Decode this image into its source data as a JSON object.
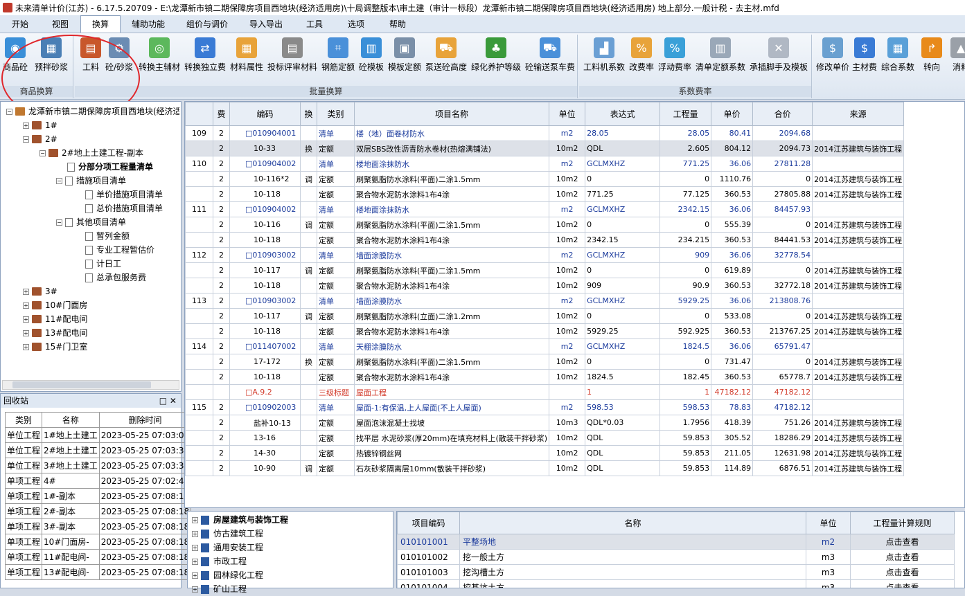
{
  "window": {
    "title": "未来清单计价(江苏) - 6.17.5.20709 - E:\\龙潭新市镇二期保障房项目西地块(经济适用房)\\十局调整版本\\审土建（审计一标段）龙潭新市镇二期保障房项目西地块(经济适用房) 地上部分.一般计税 - 去主材.mfd"
  },
  "menu": [
    "开始",
    "视图",
    "换算",
    "辅助功能",
    "组价与调价",
    "导入导出",
    "工具",
    "选项",
    "帮助"
  ],
  "ribbon": {
    "group1": {
      "label": "商品换算",
      "buttons": [
        "商品砼",
        "预拌砂浆"
      ]
    },
    "group2": {
      "label": "批量换算",
      "buttons": [
        "工料",
        "砼/砂浆",
        "转换主辅材",
        "转换独立费",
        "材料属性",
        "投标评审材料",
        "钢筋定额",
        "砼模板",
        "模板定额",
        "泵送砼高度",
        "绿化养护等级",
        "砼输送泵车费"
      ]
    },
    "group3": {
      "label": "系数费率",
      "buttons": [
        "工料机系数",
        "改费率",
        "浮动费率",
        "清单定额系数",
        "承插脚手及模板"
      ]
    },
    "group4": {
      "buttons": [
        "修改单价",
        "主材费",
        "综合系数",
        "转向",
        "消耗"
      ]
    }
  },
  "colors": {
    "accent": "#1a3a9c",
    "level": "#d23a2a",
    "annotation": "#e0262b"
  },
  "tree": {
    "root": "龙潭新市镇二期保障房项目西地块(经济适用房)",
    "items": [
      "1#",
      "2#",
      "2#地上土建工程-副本",
      "分部分项工程量清单",
      "措施项目清单",
      "单价措施项目清单",
      "总价措施项目清单",
      "其他项目清单",
      "暂列金额",
      "专业工程暂估价",
      "计日工",
      "总承包服务费",
      "3#",
      "10#门面房",
      "11#配电间",
      "13#配电间",
      "15#门卫室"
    ]
  },
  "recycle": {
    "title": "回收站",
    "headers": [
      "类别",
      "名称",
      "删除时间"
    ],
    "rows": [
      [
        "单位工程",
        "1#地上土建工",
        "2023-05-25 07:03:07"
      ],
      [
        "单位工程",
        "2#地上土建工",
        "2023-05-25 07:03:33"
      ],
      [
        "单位工程",
        "3#地上土建工",
        "2023-05-25 07:03:39"
      ],
      [
        "单项工程",
        "4#",
        "2023-05-25 07:02:48"
      ],
      [
        "单项工程",
        "1#-副本",
        "2023-05-25 07:08:18"
      ],
      [
        "单项工程",
        "2#-副本",
        "2023-05-25 07:08:18"
      ],
      [
        "单项工程",
        "3#-副本",
        "2023-05-25 07:08:18"
      ],
      [
        "单项工程",
        "10#门面房-",
        "2023-05-25 07:08:18"
      ],
      [
        "单项工程",
        "11#配电间-",
        "2023-05-25 07:08:18"
      ],
      [
        "单项工程",
        "13#配电间-",
        "2023-05-25 07:08:18"
      ]
    ]
  },
  "grid": {
    "headers": [
      "",
      "费",
      "编码",
      "换",
      "类别",
      "项目名称",
      "单位",
      "表达式",
      "工程量",
      "单价",
      "合价",
      "来源"
    ],
    "rows": [
      [
        "109",
        "2",
        "□010904001",
        "",
        "清单",
        "楼（地）面卷材防水",
        "m2",
        "28.05",
        "28.05",
        "80.41",
        "2094.68",
        ""
      ],
      [
        "",
        "2",
        "10-33",
        "换",
        "定额",
        "双层SBS改性沥青防水卷材(热熔满铺法)",
        "10m2",
        "QDL",
        "2.605",
        "804.12",
        "2094.73",
        "2014江苏建筑与装饰工程"
      ],
      [
        "110",
        "2",
        "□010904002",
        "",
        "清单",
        "楼地面涂抹防水",
        "m2",
        "GCLMXHZ",
        "771.25",
        "36.06",
        "27811.28",
        ""
      ],
      [
        "",
        "2",
        "10-116*2",
        "调",
        "定额",
        "刷聚氨脂防水涂料(平面)二涂1.5mm",
        "10m2",
        "0",
        "0",
        "1110.76",
        "0",
        "2014江苏建筑与装饰工程"
      ],
      [
        "",
        "2",
        "10-118",
        "",
        "定额",
        "聚合物水泥防水涂料1布4涂",
        "10m2",
        "771.25",
        "77.125",
        "360.53",
        "27805.88",
        "2014江苏建筑与装饰工程"
      ],
      [
        "111",
        "2",
        "□010904002",
        "",
        "清单",
        "楼地面涂抹防水",
        "m2",
        "GCLMXHZ",
        "2342.15",
        "36.06",
        "84457.93",
        ""
      ],
      [
        "",
        "2",
        "10-116",
        "调",
        "定额",
        "刷聚氨脂防水涂料(平面)二涂1.5mm",
        "10m2",
        "0",
        "0",
        "555.39",
        "0",
        "2014江苏建筑与装饰工程"
      ],
      [
        "",
        "2",
        "10-118",
        "",
        "定额",
        "聚合物水泥防水涂料1布4涂",
        "10m2",
        "2342.15",
        "234.215",
        "360.53",
        "84441.53",
        "2014江苏建筑与装饰工程"
      ],
      [
        "112",
        "2",
        "□010903002",
        "",
        "清单",
        "墙面涂膜防水",
        "m2",
        "GCLMXHZ",
        "909",
        "36.06",
        "32778.54",
        ""
      ],
      [
        "",
        "2",
        "10-117",
        "调",
        "定额",
        "刷聚氨脂防水涂料(平面)二涂1.5mm",
        "10m2",
        "0",
        "0",
        "619.89",
        "0",
        "2014江苏建筑与装饰工程"
      ],
      [
        "",
        "2",
        "10-118",
        "",
        "定额",
        "聚合物水泥防水涂料1布4涂",
        "10m2",
        "909",
        "90.9",
        "360.53",
        "32772.18",
        "2014江苏建筑与装饰工程"
      ],
      [
        "113",
        "2",
        "□010903002",
        "",
        "清单",
        "墙面涂膜防水",
        "m2",
        "GCLMXHZ",
        "5929.25",
        "36.06",
        "213808.76",
        ""
      ],
      [
        "",
        "2",
        "10-117",
        "调",
        "定额",
        "刷聚氨脂防水涂料(立面)二涂1.2mm",
        "10m2",
        "0",
        "0",
        "533.08",
        "0",
        "2014江苏建筑与装饰工程"
      ],
      [
        "",
        "2",
        "10-118",
        "",
        "定额",
        "聚合物水泥防水涂料1布4涂",
        "10m2",
        "5929.25",
        "592.925",
        "360.53",
        "213767.25",
        "2014江苏建筑与装饰工程"
      ],
      [
        "114",
        "2",
        "□011407002",
        "",
        "清单",
        "天棚涂膜防水",
        "m2",
        "GCLMXHZ",
        "1824.5",
        "36.06",
        "65791.47",
        ""
      ],
      [
        "",
        "2",
        "17-172",
        "换",
        "定额",
        "刷聚氨脂防水涂料(平面)二涂1.5mm",
        "10m2",
        "0",
        "0",
        "731.47",
        "0",
        "2014江苏建筑与装饰工程"
      ],
      [
        "",
        "2",
        "10-118",
        "",
        "定额",
        "聚合物水泥防水涂料1布4涂",
        "10m2",
        "1824.5",
        "182.45",
        "360.53",
        "65778.7",
        "2014江苏建筑与装饰工程"
      ],
      [
        "",
        "",
        "□A.9.2",
        "",
        "三级标题",
        "屋面工程",
        "",
        "1",
        "1",
        "47182.12",
        "47182.12",
        ""
      ],
      [
        "115",
        "2",
        "□010902003",
        "",
        "清单",
        "屋面-1:有保温,上人屋面(不上人屋面)",
        "m2",
        "598.53",
        "598.53",
        "78.83",
        "47182.12",
        ""
      ],
      [
        "",
        "2",
        "盐补10-13",
        "",
        "定额",
        "屋面泡沫混凝土找坡",
        "10m3",
        "QDL*0.03",
        "1.7956",
        "418.39",
        "751.26",
        "2014江苏建筑与装饰工程"
      ],
      [
        "",
        "2",
        "13-16",
        "",
        "定额",
        "找平层 水泥砂浆(厚20mm)在填充材料上(散装干拌砂浆)",
        "10m2",
        "QDL",
        "59.853",
        "305.52",
        "18286.29",
        "2014江苏建筑与装饰工程"
      ],
      [
        "",
        "2",
        "14-30",
        "",
        "定额",
        "热镀锌钢丝网",
        "10m2",
        "QDL",
        "59.853",
        "211.05",
        "12631.98",
        "2014江苏建筑与装饰工程"
      ],
      [
        "",
        "2",
        "10-90",
        "调",
        "定额",
        "石灰砂浆隔离层10mm(散装干拌砂浆)",
        "10m2",
        "QDL",
        "59.853",
        "114.89",
        "6876.51",
        "2014江苏建筑与装饰工程"
      ]
    ]
  },
  "library": [
    "房屋建筑与装饰工程",
    "仿古建筑工程",
    "通用安装工程",
    "市政工程",
    "园林绿化工程",
    "矿山工程"
  ],
  "listing": {
    "headers": [
      "项目编码",
      "名称",
      "单位",
      "工程量计算规则"
    ],
    "rows": [
      [
        "010101001",
        "平整场地",
        "m2",
        "点击查看"
      ],
      [
        "010101002",
        "挖一般土方",
        "m3",
        "点击查看"
      ],
      [
        "010101003",
        "挖沟槽土方",
        "m3",
        "点击查看"
      ],
      [
        "010101004",
        "挖基坑土方",
        "m3",
        "点击查看"
      ]
    ]
  }
}
